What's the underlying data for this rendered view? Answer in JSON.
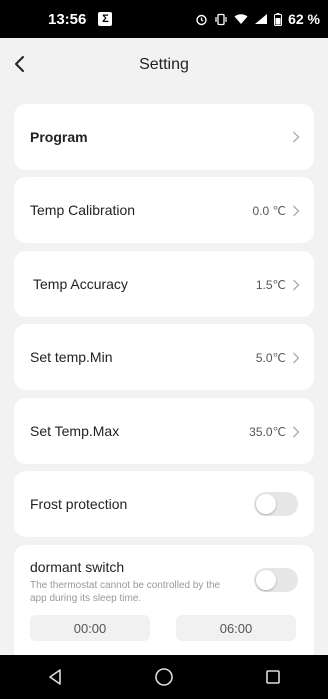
{
  "status_bar": {
    "time": "13:56",
    "sigma_badge": "Σ",
    "battery": "62 %"
  },
  "header": {
    "title": "Setting"
  },
  "rows": {
    "program": {
      "label": "Program"
    },
    "temp_calibration": {
      "label": "Temp Calibration",
      "value": "0.0 ℃"
    },
    "temp_accuracy": {
      "label": "Temp Accuracy",
      "value": "1.5℃"
    },
    "set_temp_min": {
      "label": "Set temp.Min",
      "value": "5.0℃"
    },
    "set_temp_max": {
      "label": "Set Temp.Max",
      "value": "35.0℃"
    },
    "frost_protection": {
      "label": "Frost protection",
      "enabled": false
    },
    "dormant_switch": {
      "label": "dormant switch",
      "description": "The thermostat cannot be controlled by the app during its sleep time.",
      "enabled": false,
      "start_time": "00:00",
      "end_time": "06:00"
    }
  },
  "icons": {
    "back": "chevron-left-icon",
    "row_arrow": "chevron-right-icon",
    "nav_back": "triangle-back-icon",
    "nav_home": "circle-home-icon",
    "nav_recents": "square-recents-icon"
  },
  "colors": {
    "background": "#f2f2f2",
    "card": "#ffffff",
    "toggle_off": "#e6e6e6"
  }
}
